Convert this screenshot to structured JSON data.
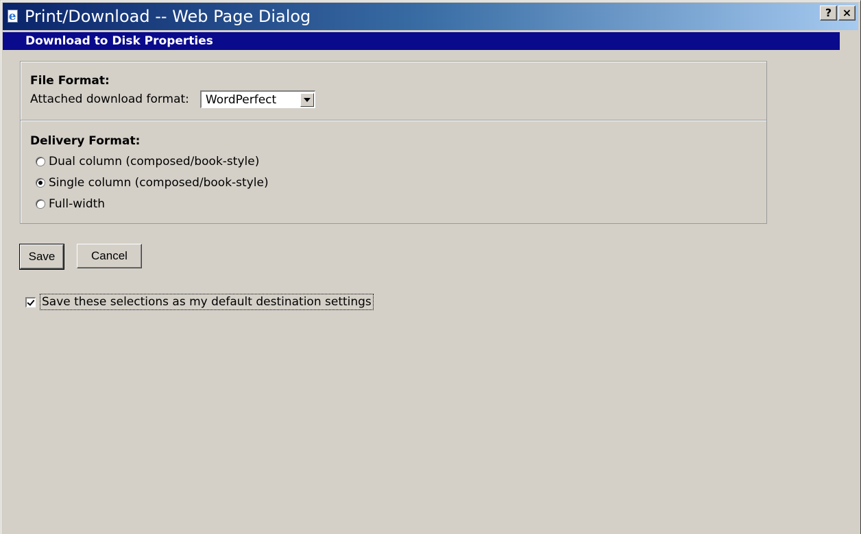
{
  "window": {
    "title": "Print/Download -- Web Page Dialog",
    "help_button": "?",
    "close_button": "×"
  },
  "header": {
    "title": "Download to Disk Properties"
  },
  "file_format": {
    "heading": "File Format:",
    "label": "Attached download format:",
    "selected": "WordPerfect"
  },
  "delivery_format": {
    "heading": "Delivery Format:",
    "options": [
      {
        "label": "Dual column (composed/book-style)",
        "checked": false
      },
      {
        "label": "Single column (composed/book-style)",
        "checked": true
      },
      {
        "label": "Full-width",
        "checked": false
      }
    ]
  },
  "actions": {
    "save_label": "Save",
    "cancel_label": "Cancel"
  },
  "defaults": {
    "label": "Save these selections as my default destination settings",
    "checked": true
  },
  "colors": {
    "titlebar_start": "#0a246a",
    "header_bar": "#0a0a8c",
    "dialog_bg": "#d4d0c8"
  }
}
